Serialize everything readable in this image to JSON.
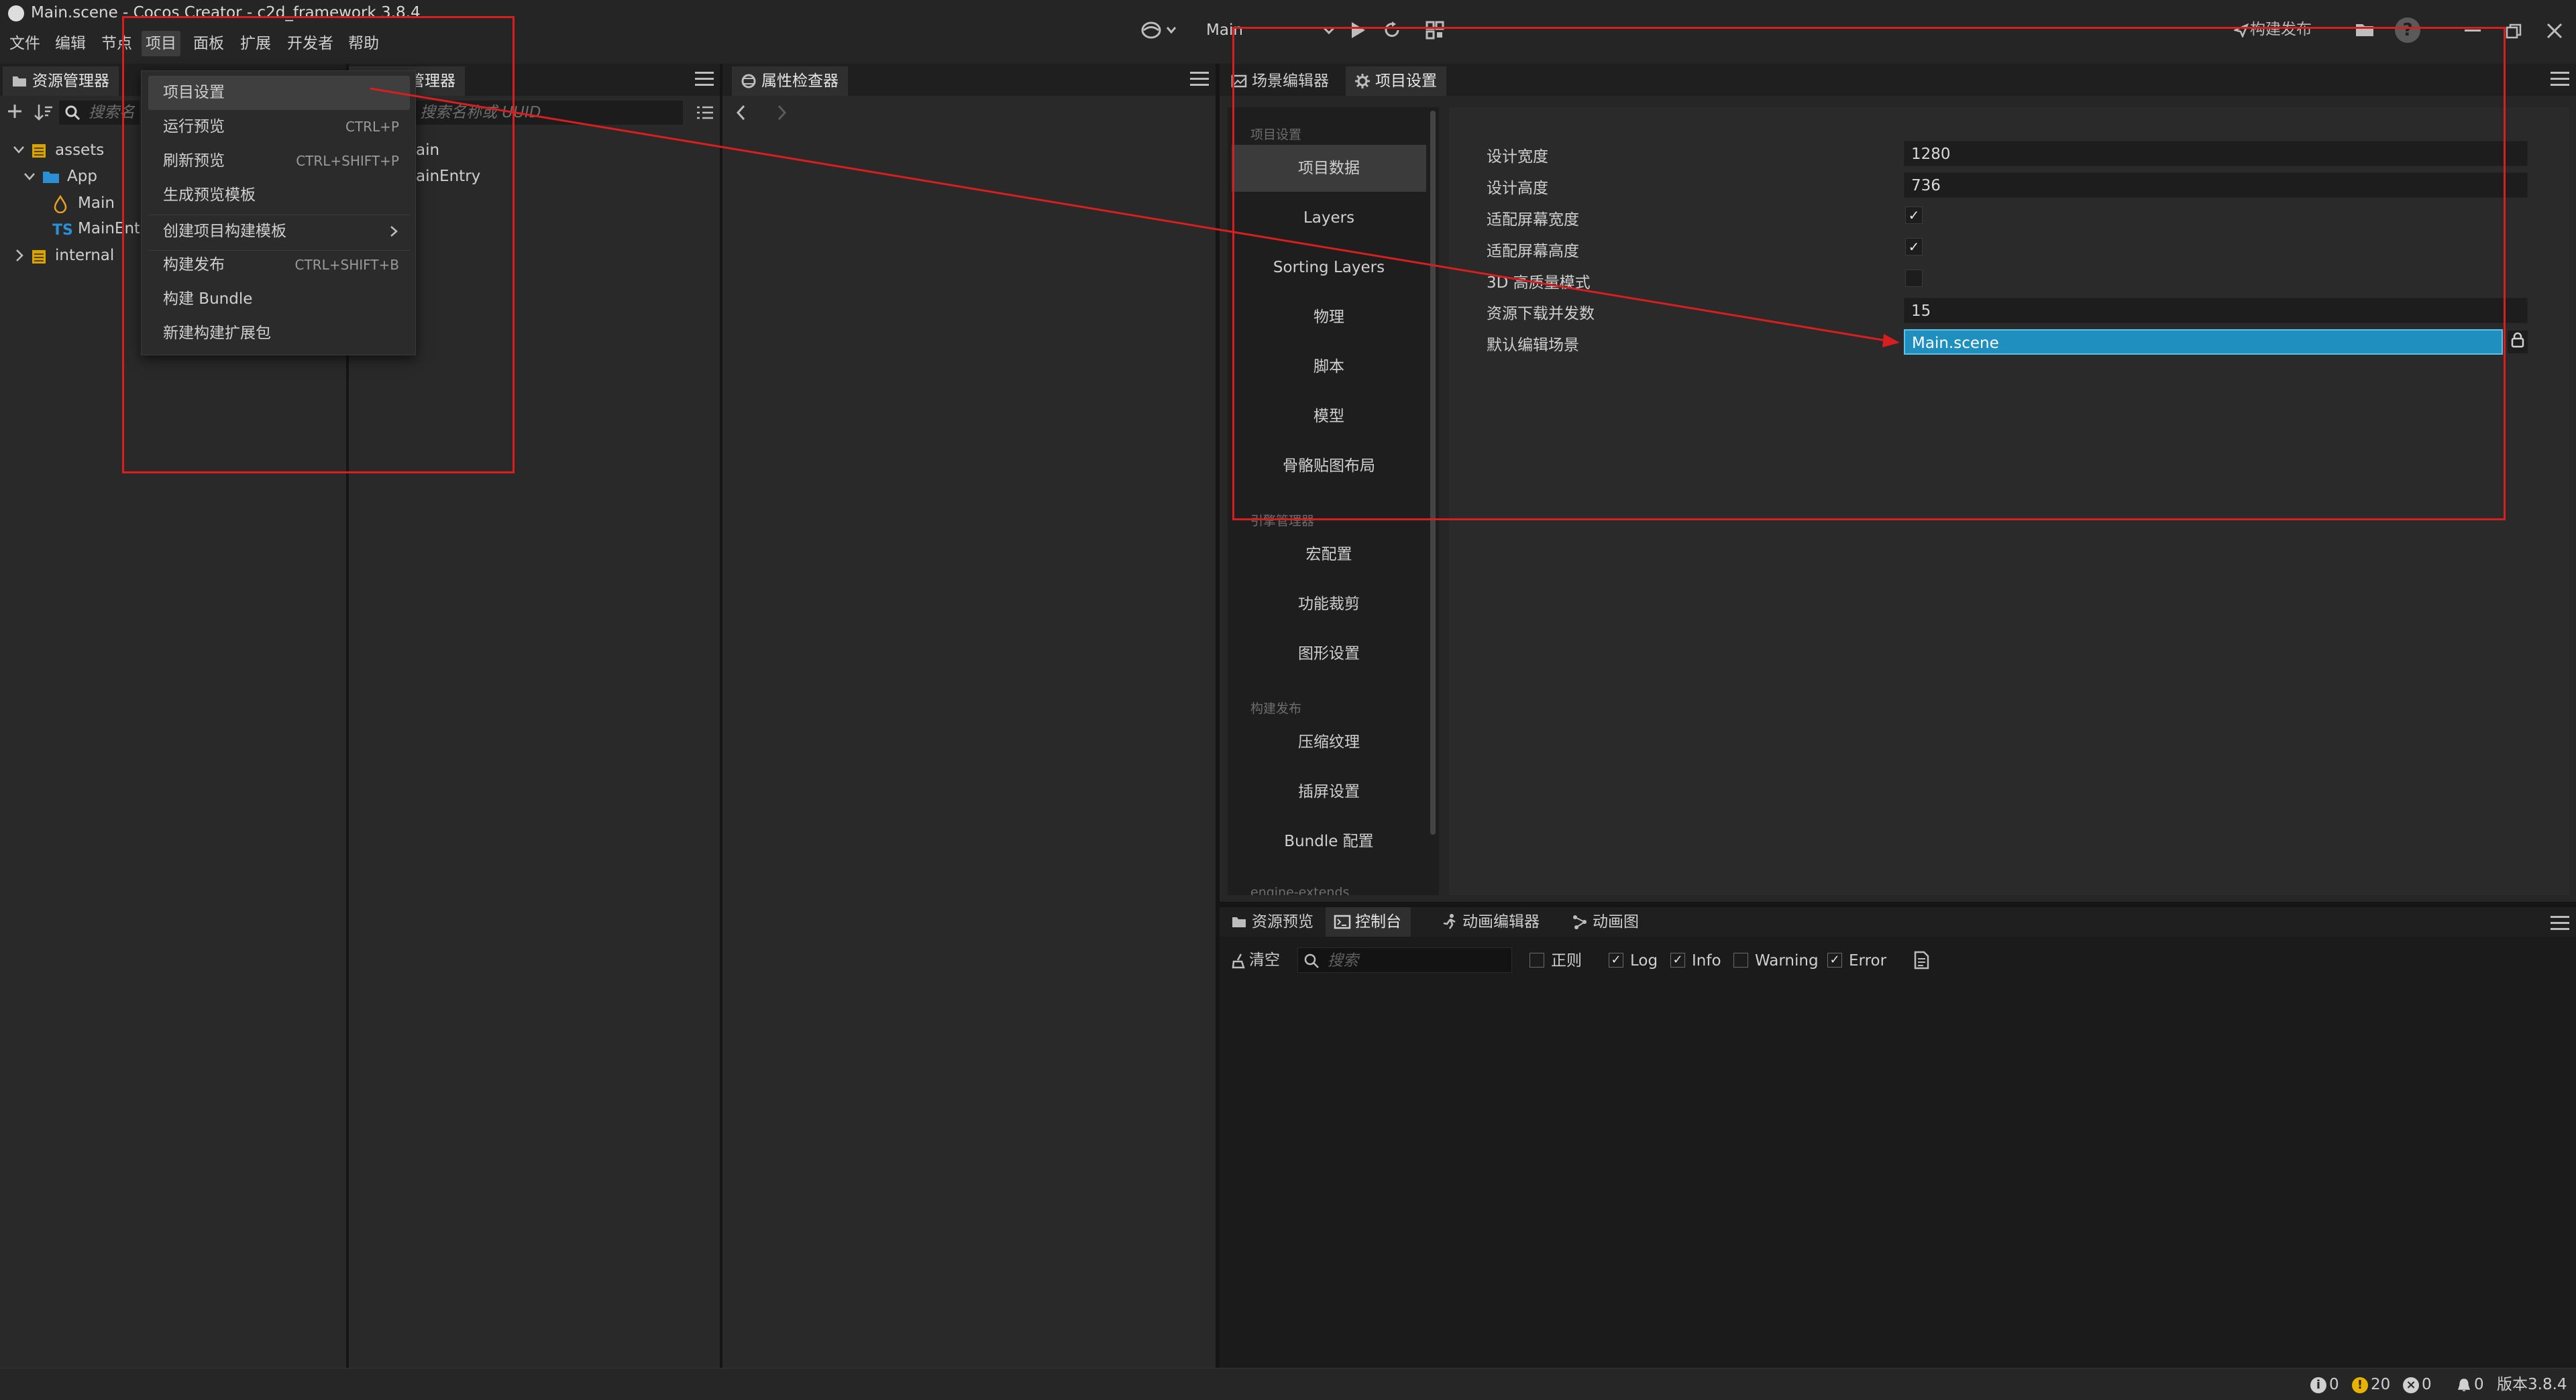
{
  "window": {
    "title": "Main.scene - Cocos Creator - c2d_framework 3.8.4"
  },
  "menubar": [
    "文件",
    "编辑",
    "节点",
    "项目",
    "面板",
    "扩展",
    "开发者",
    "帮助"
  ],
  "toolbar": {
    "scene_select": "Main",
    "publish_label": "构建发布"
  },
  "assets_panel": {
    "tab": "资源管理器",
    "search_placeholder": "搜索名",
    "tree": [
      {
        "label": "assets",
        "icon": "db-icon"
      },
      {
        "label": "App",
        "icon": "folder-icon"
      },
      {
        "label": "Main",
        "icon": "scene-icon"
      },
      {
        "label": "MainEntry",
        "icon": "ts-icon",
        "prefix": "TS"
      },
      {
        "label": "internal",
        "icon": "db-icon"
      }
    ]
  },
  "hierarchy_panel": {
    "tab": "管理器",
    "search_placeholder": "搜索名称或 UUID",
    "rows": [
      "ain",
      "ainEntry"
    ]
  },
  "inspector_panel": {
    "tab": "属性检查器"
  },
  "project_menu": {
    "items": [
      {
        "label": "项目设置",
        "shortcut": ""
      },
      {
        "label": "运行预览",
        "shortcut": "CTRL+P"
      },
      {
        "label": "刷新预览",
        "shortcut": "CTRL+SHIFT+P"
      },
      {
        "label": "生成预览模板",
        "shortcut": ""
      },
      {
        "label": "创建项目构建模板",
        "shortcut": ""
      },
      {
        "label": "构建发布",
        "shortcut": "CTRL+SHIFT+B"
      },
      {
        "label": "构建 Bundle",
        "shortcut": ""
      },
      {
        "label": "新建构建扩展包",
        "shortcut": ""
      }
    ]
  },
  "right_tabs": {
    "scene_editor": "场景编辑器",
    "project_settings": "项目设置"
  },
  "project_settings": {
    "sections": {
      "project": "项目设置",
      "engine": "引擎管理器",
      "build": "构建发布",
      "extends": "engine-extends"
    },
    "nav": [
      "项目数据",
      "Layers",
      "Sorting Layers",
      "物理",
      "脚本",
      "模型",
      "骨骼贴图布局",
      "宏配置",
      "功能裁剪",
      "图形设置",
      "压缩纹理",
      "插屏设置",
      "Bundle 配置"
    ],
    "fields": {
      "design_width_label": "设计宽度",
      "design_width": "1280",
      "design_height_label": "设计高度",
      "design_height": "736",
      "fit_width_label": "适配屏幕宽度",
      "fit_width": true,
      "fit_height_label": "适配屏幕高度",
      "fit_height": true,
      "hq_3d_label": "3D 高质量模式",
      "hq_3d": false,
      "download_label": "资源下载并发数",
      "download": "15",
      "default_scene_label": "默认编辑场景",
      "default_scene": "Main.scene"
    }
  },
  "bottom_tabs": {
    "asset_preview": "资源预览",
    "console": "控制台",
    "animation_editor": "动画编辑器",
    "animation_graph": "动画图"
  },
  "console": {
    "clear": "清空",
    "search_placeholder": "搜索",
    "filters": [
      {
        "label": "正则",
        "checked": false
      },
      {
        "label": "Log",
        "checked": true
      },
      {
        "label": "Info",
        "checked": true
      },
      {
        "label": "Warning",
        "checked": false
      },
      {
        "label": "Error",
        "checked": true
      }
    ]
  },
  "status": {
    "info_count": "0",
    "warn_count": "20",
    "error_count": "0",
    "notify_count": "0",
    "version": "版本3.8.4"
  },
  "colors": {
    "accent": "#1f8fc0",
    "annotation": "#d81e1e",
    "warn": "#e8b300"
  }
}
